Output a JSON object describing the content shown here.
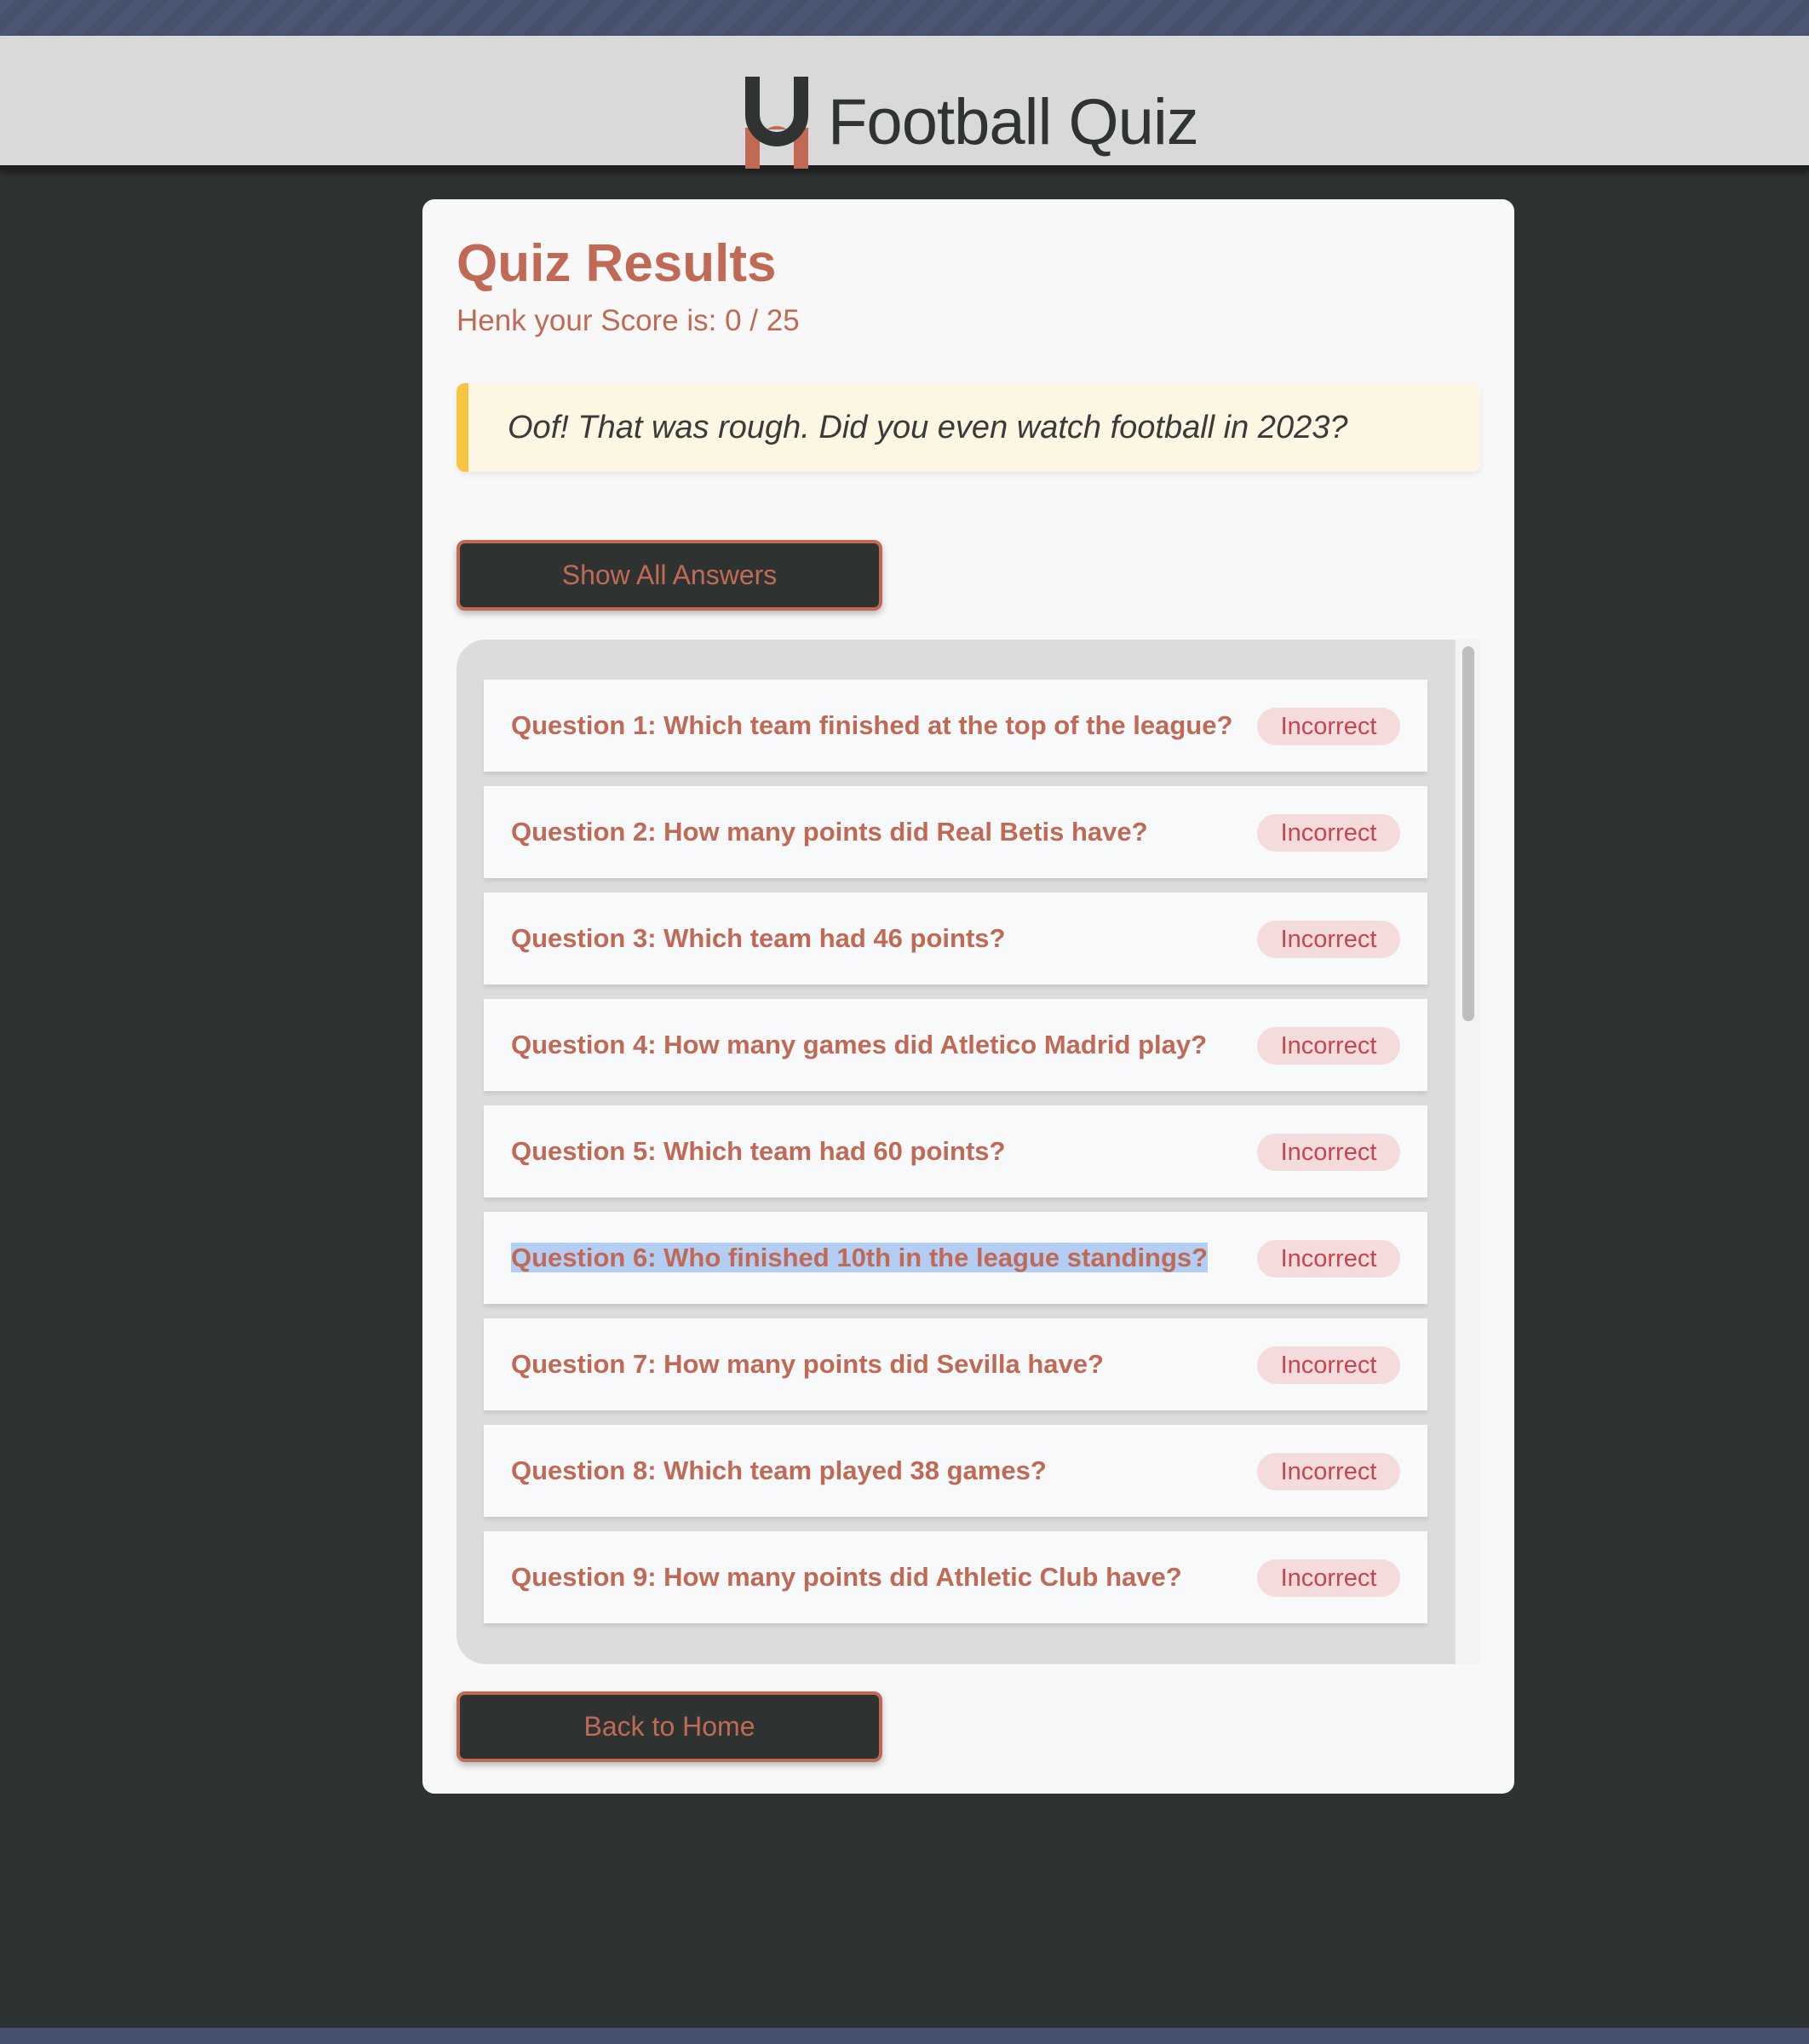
{
  "header": {
    "app_title": "Football Quiz",
    "logo_icon": "horseshoe-logo-icon"
  },
  "results": {
    "title": "Quiz Results",
    "score_text": "Henk your Score is: 0 / 25",
    "message": "Oof! That was rough. Did you even watch football in 2023?"
  },
  "buttons": {
    "show_answers": "Show All Answers",
    "back_home": "Back to Home"
  },
  "questions": [
    {
      "text": "Question 1: Which team finished at the top of the league?",
      "status": "Incorrect"
    },
    {
      "text": "Question 2: How many points did Real Betis have?",
      "status": "Incorrect"
    },
    {
      "text": "Question 3: Which team had 46 points?",
      "status": "Incorrect"
    },
    {
      "text": "Question 4: How many games did Atletico Madrid play?",
      "status": "Incorrect"
    },
    {
      "text": "Question 5: Which team had 60 points?",
      "status": "Incorrect"
    },
    {
      "text": "Question 6: Who finished 10th in the league standings?",
      "status": "Incorrect",
      "selected": true
    },
    {
      "text": "Question 7: How many points did Sevilla have?",
      "status": "Incorrect"
    },
    {
      "text": "Question 8: Which team played 38 games?",
      "status": "Incorrect"
    },
    {
      "text": "Question 9: How many points did Athletic Club have?",
      "status": "Incorrect"
    }
  ],
  "colors": {
    "accent": "#c06a55",
    "dark": "#2e3331",
    "callout_border": "#f7c544",
    "badge_bg": "#f4dcdc",
    "badge_text": "#c8454f"
  }
}
